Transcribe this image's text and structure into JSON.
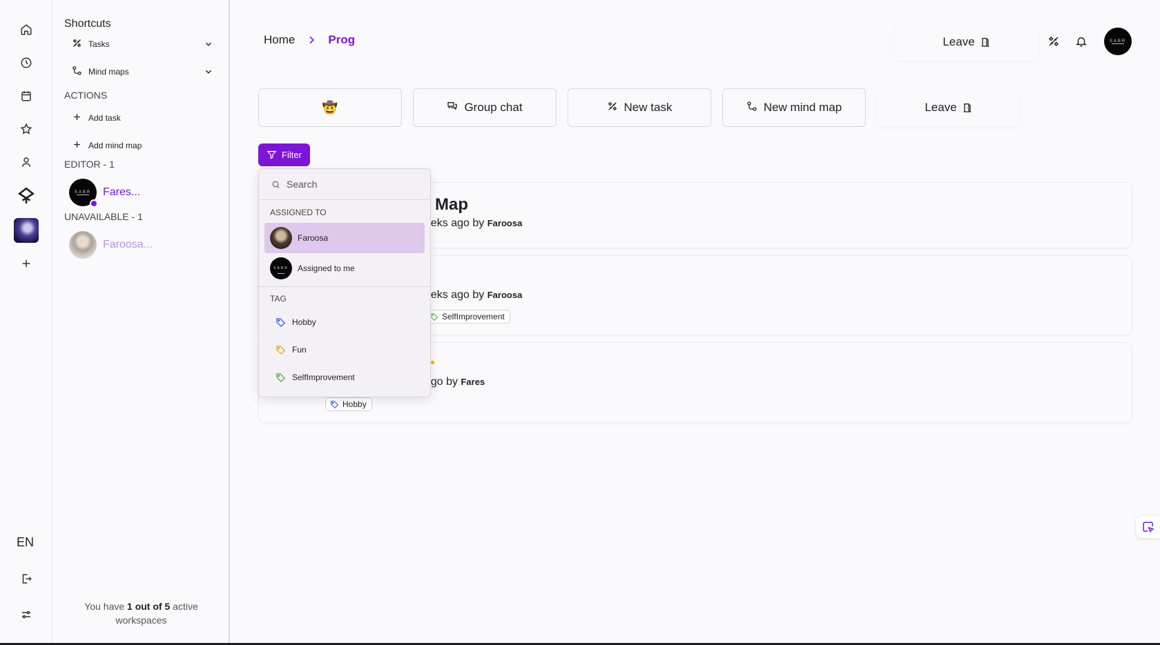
{
  "rail": {
    "icons": [
      "home-icon",
      "clock-icon",
      "calendar-icon",
      "star-icon",
      "user-icon",
      "app-logo-icon",
      "workspace-thumbnail",
      "plus-icon"
    ],
    "language": "EN",
    "bottom_icons": [
      "logout-icon",
      "settings-sliders-icon"
    ]
  },
  "sidebar": {
    "title": "Shortcuts",
    "shortcuts": [
      {
        "label": "Tasks",
        "icon": "tasks-icon"
      },
      {
        "label": "Mind maps",
        "icon": "mindmap-icon"
      }
    ],
    "actions_header": "ACTIONS",
    "actions": [
      {
        "label": "Add task"
      },
      {
        "label": "Add mind map"
      }
    ],
    "editor_header": "EDITOR - 1",
    "editor_member": "Fares...",
    "unavailable_header": "UNAVAILABLE - 1",
    "unavailable_member": "Faroosa...",
    "workspace_count": {
      "prefix": "You have ",
      "bold": "1 out of 5",
      "suffix": " active",
      "line2": "workspaces"
    }
  },
  "header": {
    "breadcrumb": {
      "home": "Home",
      "current": "Prog"
    },
    "leave": "Leave",
    "avatar_text": "SABR"
  },
  "actions": {
    "emoji": "🤠",
    "group_chat": "Group chat",
    "new_task": "New task",
    "new_mind_map": "New mind map",
    "leave": "Leave"
  },
  "filter": {
    "label": "Filter"
  },
  "cards": [
    {
      "title": "Map",
      "meta_prefix": "eeks ago by ",
      "author": "Faroosa"
    },
    {
      "meta_prefix": "eeks ago by ",
      "author": "Faroosa",
      "tag": "SelfImprovement"
    },
    {
      "meta_prefix": "ago by ",
      "author": "Fares",
      "tag": "Hobby"
    }
  ],
  "dropdown": {
    "search_placeholder": "Search",
    "assigned_header": "ASSIGNED TO",
    "assigned": [
      {
        "label": "Faroosa",
        "selected": true
      },
      {
        "label": "Assigned to me",
        "selected": false
      }
    ],
    "tag_header": "TAG",
    "tags": [
      {
        "label": "Hobby",
        "color": "#3b5bdb"
      },
      {
        "label": "Fun",
        "color": "#e8a317"
      },
      {
        "label": "SelfImprovement",
        "color": "#5aa832"
      }
    ]
  },
  "colors": {
    "accent": "#7c16d6",
    "background": "#fafafc"
  }
}
